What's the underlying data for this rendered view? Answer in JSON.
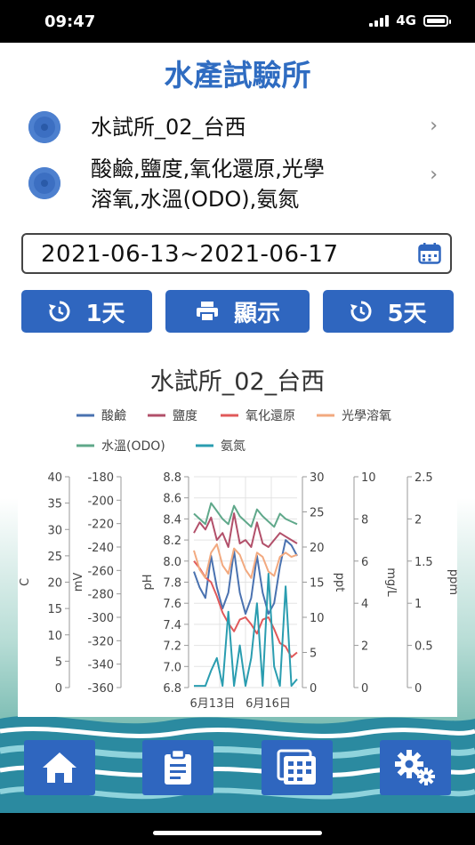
{
  "status": {
    "time": "09:47",
    "network": "4G"
  },
  "app": {
    "title": "水產試驗所"
  },
  "station": {
    "label": "水試所_02_台西",
    "icon": "station-dot-icon"
  },
  "params": {
    "line1": "酸鹼,鹽度,氧化還原,光學",
    "line2": "溶氧,水溫(ODO),氨氮",
    "icon": "station-dot-icon"
  },
  "date_range": {
    "value": "2021-06-13~2021-06-17",
    "icon": "calendar-icon"
  },
  "buttons": {
    "one_day": {
      "label": "1天",
      "icon": "history-icon"
    },
    "display": {
      "label": "顯示",
      "icon": "printer-icon"
    },
    "five_day": {
      "label": "5天",
      "icon": "history-icon"
    }
  },
  "nav": [
    {
      "icon": "home-icon"
    },
    {
      "icon": "clipboard-icon"
    },
    {
      "icon": "gallery-icon"
    },
    {
      "icon": "gears-icon"
    }
  ],
  "colors": {
    "accent": "#2f66bf",
    "ph": "#4a72b0",
    "salinity": "#b2506a",
    "orp": "#e0595a",
    "do": "#f2a97f",
    "temp": "#5fa88a",
    "ammonia": "#2a9db0"
  },
  "chart_data": {
    "type": "line",
    "title": "水試所_02_台西",
    "legend": [
      "酸鹼",
      "鹽度",
      "氧化還原",
      "光學溶氧",
      "水溫(ODO)",
      "氨氮"
    ],
    "legend_placement": "top",
    "axes": [
      {
        "label": "C",
        "range": [
          0,
          40
        ],
        "ticks": [
          "0",
          "5",
          "10",
          "15",
          "20",
          "25",
          "30",
          "35",
          "40"
        ]
      },
      {
        "label": "mV",
        "range": [
          -360,
          -180
        ],
        "ticks": [
          "-360",
          "-340",
          "-320",
          "-300",
          "-280",
          "-260",
          "-240",
          "-220",
          "-200",
          "-180"
        ]
      },
      {
        "label": "pH",
        "range": [
          6.8,
          8.8
        ],
        "ticks": [
          "6.8",
          "7.0",
          "7.2",
          "7.4",
          "7.6",
          "7.8",
          "8.0",
          "8.2",
          "8.4",
          "8.6",
          "8.8"
        ]
      },
      {
        "label": "ppt",
        "range": [
          0,
          30
        ],
        "ticks": [
          "0",
          "5",
          "10",
          "15",
          "20",
          "25",
          "30"
        ]
      },
      {
        "label": "mg/L",
        "range": [
          0,
          10
        ],
        "ticks": [
          "0",
          "2",
          "4",
          "6",
          "8",
          "10"
        ]
      },
      {
        "label": "ppm",
        "range": [
          0,
          2.5
        ],
        "ticks": [
          "0",
          "0.5",
          "1",
          "1.5",
          "2",
          "2.5"
        ]
      }
    ],
    "x_ticks": [
      "6月13日",
      "6月16日"
    ],
    "x": [
      0,
      0.25,
      0.5,
      0.75,
      1,
      1.25,
      1.5,
      1.75,
      2,
      2.25,
      2.5,
      2.75,
      3,
      3.25,
      3.5,
      3.75,
      4,
      4.25,
      4.5
    ],
    "series": [
      {
        "name": "酸鹼",
        "axis": 2,
        "values": [
          7.9,
          7.75,
          7.65,
          8.05,
          7.75,
          7.55,
          7.7,
          8.1,
          7.7,
          7.5,
          7.65,
          8.05,
          7.7,
          7.5,
          7.6,
          7.95,
          8.2,
          8.15,
          8.05
        ]
      },
      {
        "name": "鹽度",
        "axis": 3,
        "values": [
          22,
          23.5,
          22.5,
          24.2,
          21,
          22,
          20,
          24.8,
          20.5,
          21,
          20,
          23.5,
          20.5,
          20,
          21,
          22,
          21.5,
          21,
          20.5
        ]
      },
      {
        "name": "氧化還原",
        "axis": 1,
        "values": [
          -252,
          -258,
          -266,
          -270,
          -282,
          -296,
          -305,
          -312,
          -302,
          -300,
          -306,
          -314,
          -302,
          -300,
          -310,
          -322,
          -325,
          -334,
          -330
        ]
      },
      {
        "name": "光學溶氧",
        "axis": 4,
        "values": [
          6.5,
          5.6,
          5.2,
          6.4,
          6.8,
          5.8,
          5.4,
          6.6,
          6.3,
          5.6,
          5.2,
          6.4,
          6.2,
          5.5,
          5.3,
          6.2,
          6.4,
          6.2,
          6.3
        ]
      },
      {
        "name": "水溫(ODO)",
        "axis": 0,
        "values": [
          33,
          32,
          31,
          35,
          33.5,
          32,
          31,
          34.5,
          32.5,
          31.5,
          30.5,
          33.8,
          32.5,
          31.5,
          30.5,
          33,
          32,
          31.5,
          31
        ]
      },
      {
        "name": "氨氮",
        "axis": 5,
        "values": [
          0.02,
          0.02,
          0.02,
          0.2,
          0.35,
          0.02,
          0.9,
          0.02,
          0.5,
          0.02,
          0.35,
          1.0,
          0.02,
          1.35,
          0.25,
          0.02,
          1.2,
          0.02,
          0.1
        ]
      }
    ]
  }
}
